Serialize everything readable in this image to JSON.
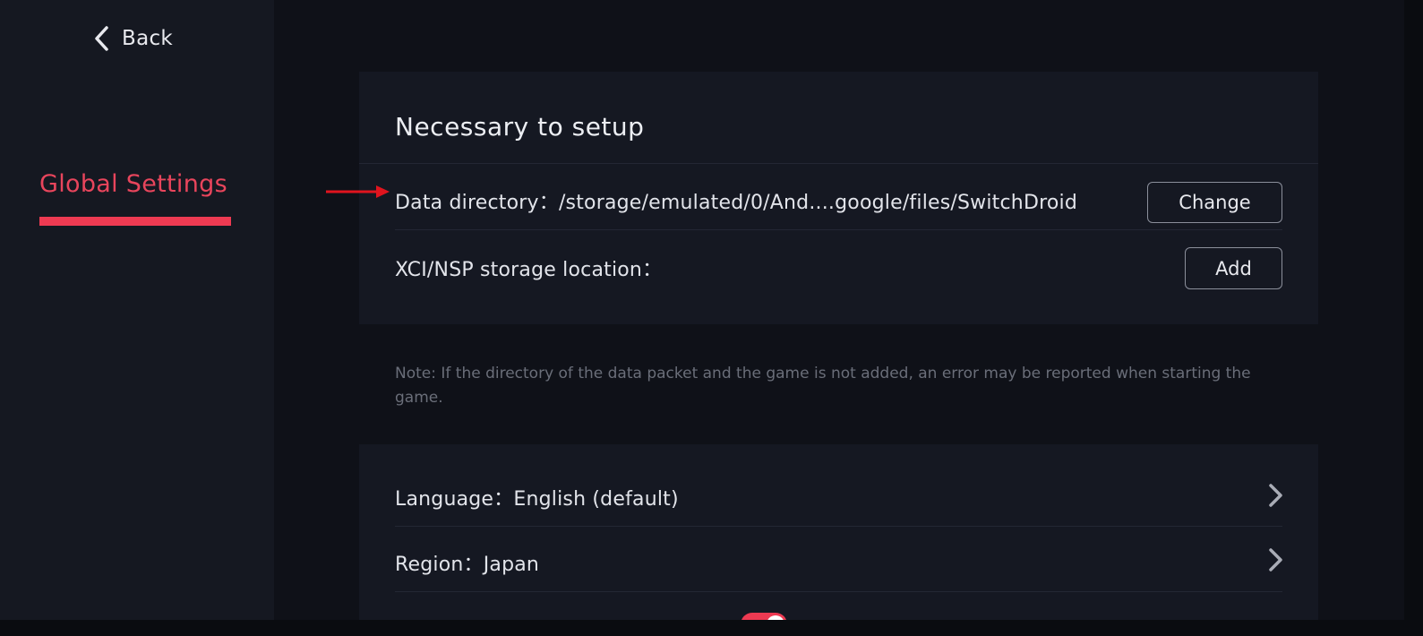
{
  "sidebar": {
    "back_label": "Back",
    "items": [
      {
        "label": "Global Settings",
        "active": true
      }
    ]
  },
  "setup": {
    "title": "Necessary to setup",
    "data_directory": {
      "label": "Data directory：/storage/emulated/0/And....google/files/SwitchDroid",
      "button": "Change"
    },
    "xci_storage": {
      "label": "XCI/NSP storage location：",
      "button": "Add"
    }
  },
  "note": "Note: If the directory of the data packet and the game is not added, an error may be reported when starting the game.",
  "settings": {
    "language": {
      "label": "Language：English (default)"
    },
    "region": {
      "label": "Region：Japan"
    },
    "partial_toggle": {
      "on": true
    }
  },
  "colors": {
    "accent": "#ee3a52",
    "annotation_arrow": "#e0141e",
    "card_background": "#151822",
    "sidebar_background": "#151821"
  },
  "icons": {
    "back": "chevron-left-icon",
    "row_open": "chevron-right-icon",
    "annotation": "arrow-right-icon"
  }
}
